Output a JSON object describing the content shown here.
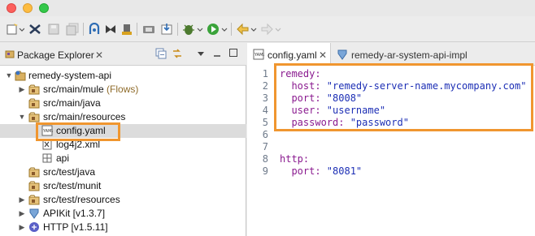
{
  "window": {
    "controls": [
      "close",
      "minimize",
      "zoom"
    ]
  },
  "toolbar": {
    "icons": [
      "new-icon",
      "mule-connector-icon",
      "save-icon",
      "save-all-icon",
      "deploy-icon",
      "anypoint-icon",
      "run-as-icon",
      "manage-icon",
      "import-icon",
      "debug-icon",
      "run-icon",
      "back-icon",
      "forward-icon"
    ]
  },
  "explorer": {
    "title": "Package Explorer",
    "tree": [
      {
        "label": "remedy-system-api",
        "suffix": "",
        "icon": "project-icon"
      },
      {
        "label": "src/main/mule",
        "suffix": "(Flows)",
        "icon": "source-folder-icon"
      },
      {
        "label": "src/main/java",
        "suffix": "",
        "icon": "source-folder-icon"
      },
      {
        "label": "src/main/resources",
        "suffix": "",
        "icon": "source-folder-icon"
      },
      {
        "label": "config.yaml",
        "suffix": "",
        "icon": "yaml-file-icon"
      },
      {
        "label": "log4j2.xml",
        "suffix": "",
        "icon": "xml-file-icon"
      },
      {
        "label": "api",
        "suffix": "",
        "icon": "api-folder-icon"
      },
      {
        "label": "src/test/java",
        "suffix": "",
        "icon": "source-folder-icon"
      },
      {
        "label": "src/test/munit",
        "suffix": "",
        "icon": "source-folder-icon"
      },
      {
        "label": "src/test/resources",
        "suffix": "",
        "icon": "source-folder-icon"
      },
      {
        "label": "APIKit [v1.3.7]",
        "suffix": "",
        "icon": "apikit-library-icon"
      },
      {
        "label": "HTTP [v1.5.11]",
        "suffix": "",
        "icon": "http-library-icon"
      }
    ]
  },
  "editor": {
    "tabs": [
      {
        "label": "config.yaml",
        "active": true
      },
      {
        "label": "remedy-ar-system-api-impl",
        "active": false
      }
    ],
    "lines": [
      {
        "n": "1",
        "key": "remedy:",
        "val": ""
      },
      {
        "n": "2",
        "key": "  host:",
        "val": " \"remedy-server-name.mycompany.com\""
      },
      {
        "n": "3",
        "key": "  port:",
        "val": " \"8008\""
      },
      {
        "n": "4",
        "key": "  user:",
        "val": " \"username\""
      },
      {
        "n": "5",
        "key": "  password:",
        "val": " \"password\""
      },
      {
        "n": "6",
        "key": "",
        "val": ""
      },
      {
        "n": "7",
        "key": "",
        "val": ""
      },
      {
        "n": "8",
        "key": "http:",
        "val": ""
      },
      {
        "n": "9",
        "key": "  port:",
        "val": " \"8081\""
      }
    ]
  },
  "colors": {
    "highlight": "#f0962f",
    "yaml_key": "#8a1a8f",
    "yaml_string": "#1d2fb5",
    "line_number": "#6e7a8a"
  }
}
